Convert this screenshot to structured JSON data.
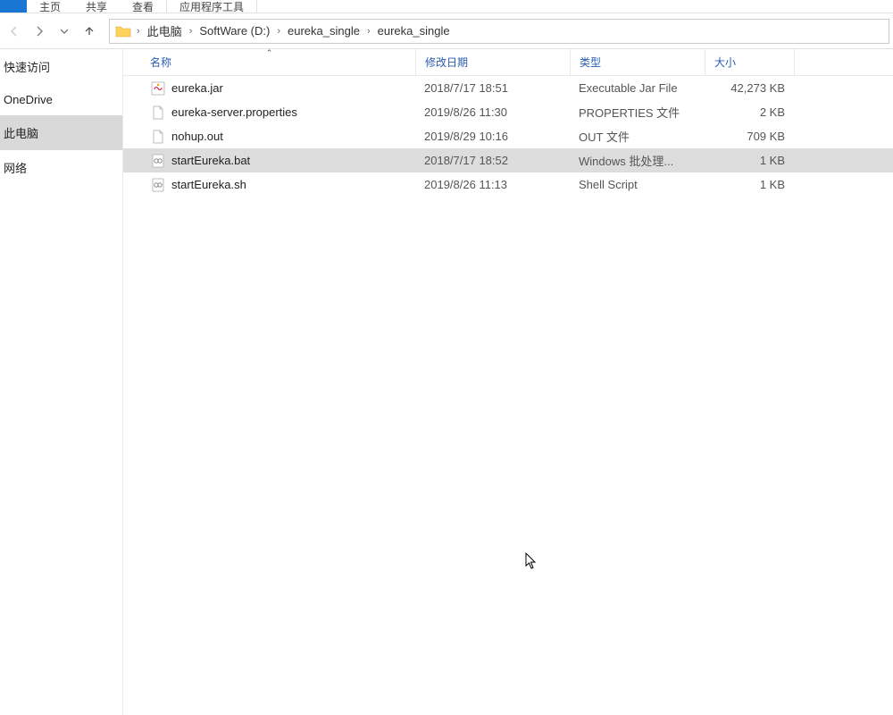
{
  "ribbon": {
    "tabs": [
      "主页",
      "共享",
      "查看",
      "应用程序工具"
    ]
  },
  "breadcrumb": {
    "items": [
      "此电脑",
      "SoftWare (D:)",
      "eureka_single",
      "eureka_single"
    ]
  },
  "sidebar": {
    "items": [
      {
        "label": "快速访问",
        "selected": false
      },
      {
        "label": "OneDrive",
        "selected": false
      },
      {
        "label": "此电脑",
        "selected": true
      },
      {
        "label": "网络",
        "selected": false
      }
    ]
  },
  "columns": {
    "name": "名称",
    "date": "修改日期",
    "type": "类型",
    "size": "大小"
  },
  "files": [
    {
      "icon": "jar",
      "name": "eureka.jar",
      "date": "2018/7/17 18:51",
      "type": "Executable Jar File",
      "size": "42,273 KB",
      "selected": false
    },
    {
      "icon": "props",
      "name": "eureka-server.properties",
      "date": "2019/8/26 11:30",
      "type": "PROPERTIES 文件",
      "size": "2 KB",
      "selected": false
    },
    {
      "icon": "out",
      "name": "nohup.out",
      "date": "2019/8/29 10:16",
      "type": "OUT 文件",
      "size": "709 KB",
      "selected": false
    },
    {
      "icon": "bat",
      "name": "startEureka.bat",
      "date": "2018/7/17 18:52",
      "type": "Windows 批处理...",
      "size": "1 KB",
      "selected": true
    },
    {
      "icon": "sh",
      "name": "startEureka.sh",
      "date": "2019/8/26 11:13",
      "type": "Shell Script",
      "size": "1 KB",
      "selected": false
    }
  ]
}
